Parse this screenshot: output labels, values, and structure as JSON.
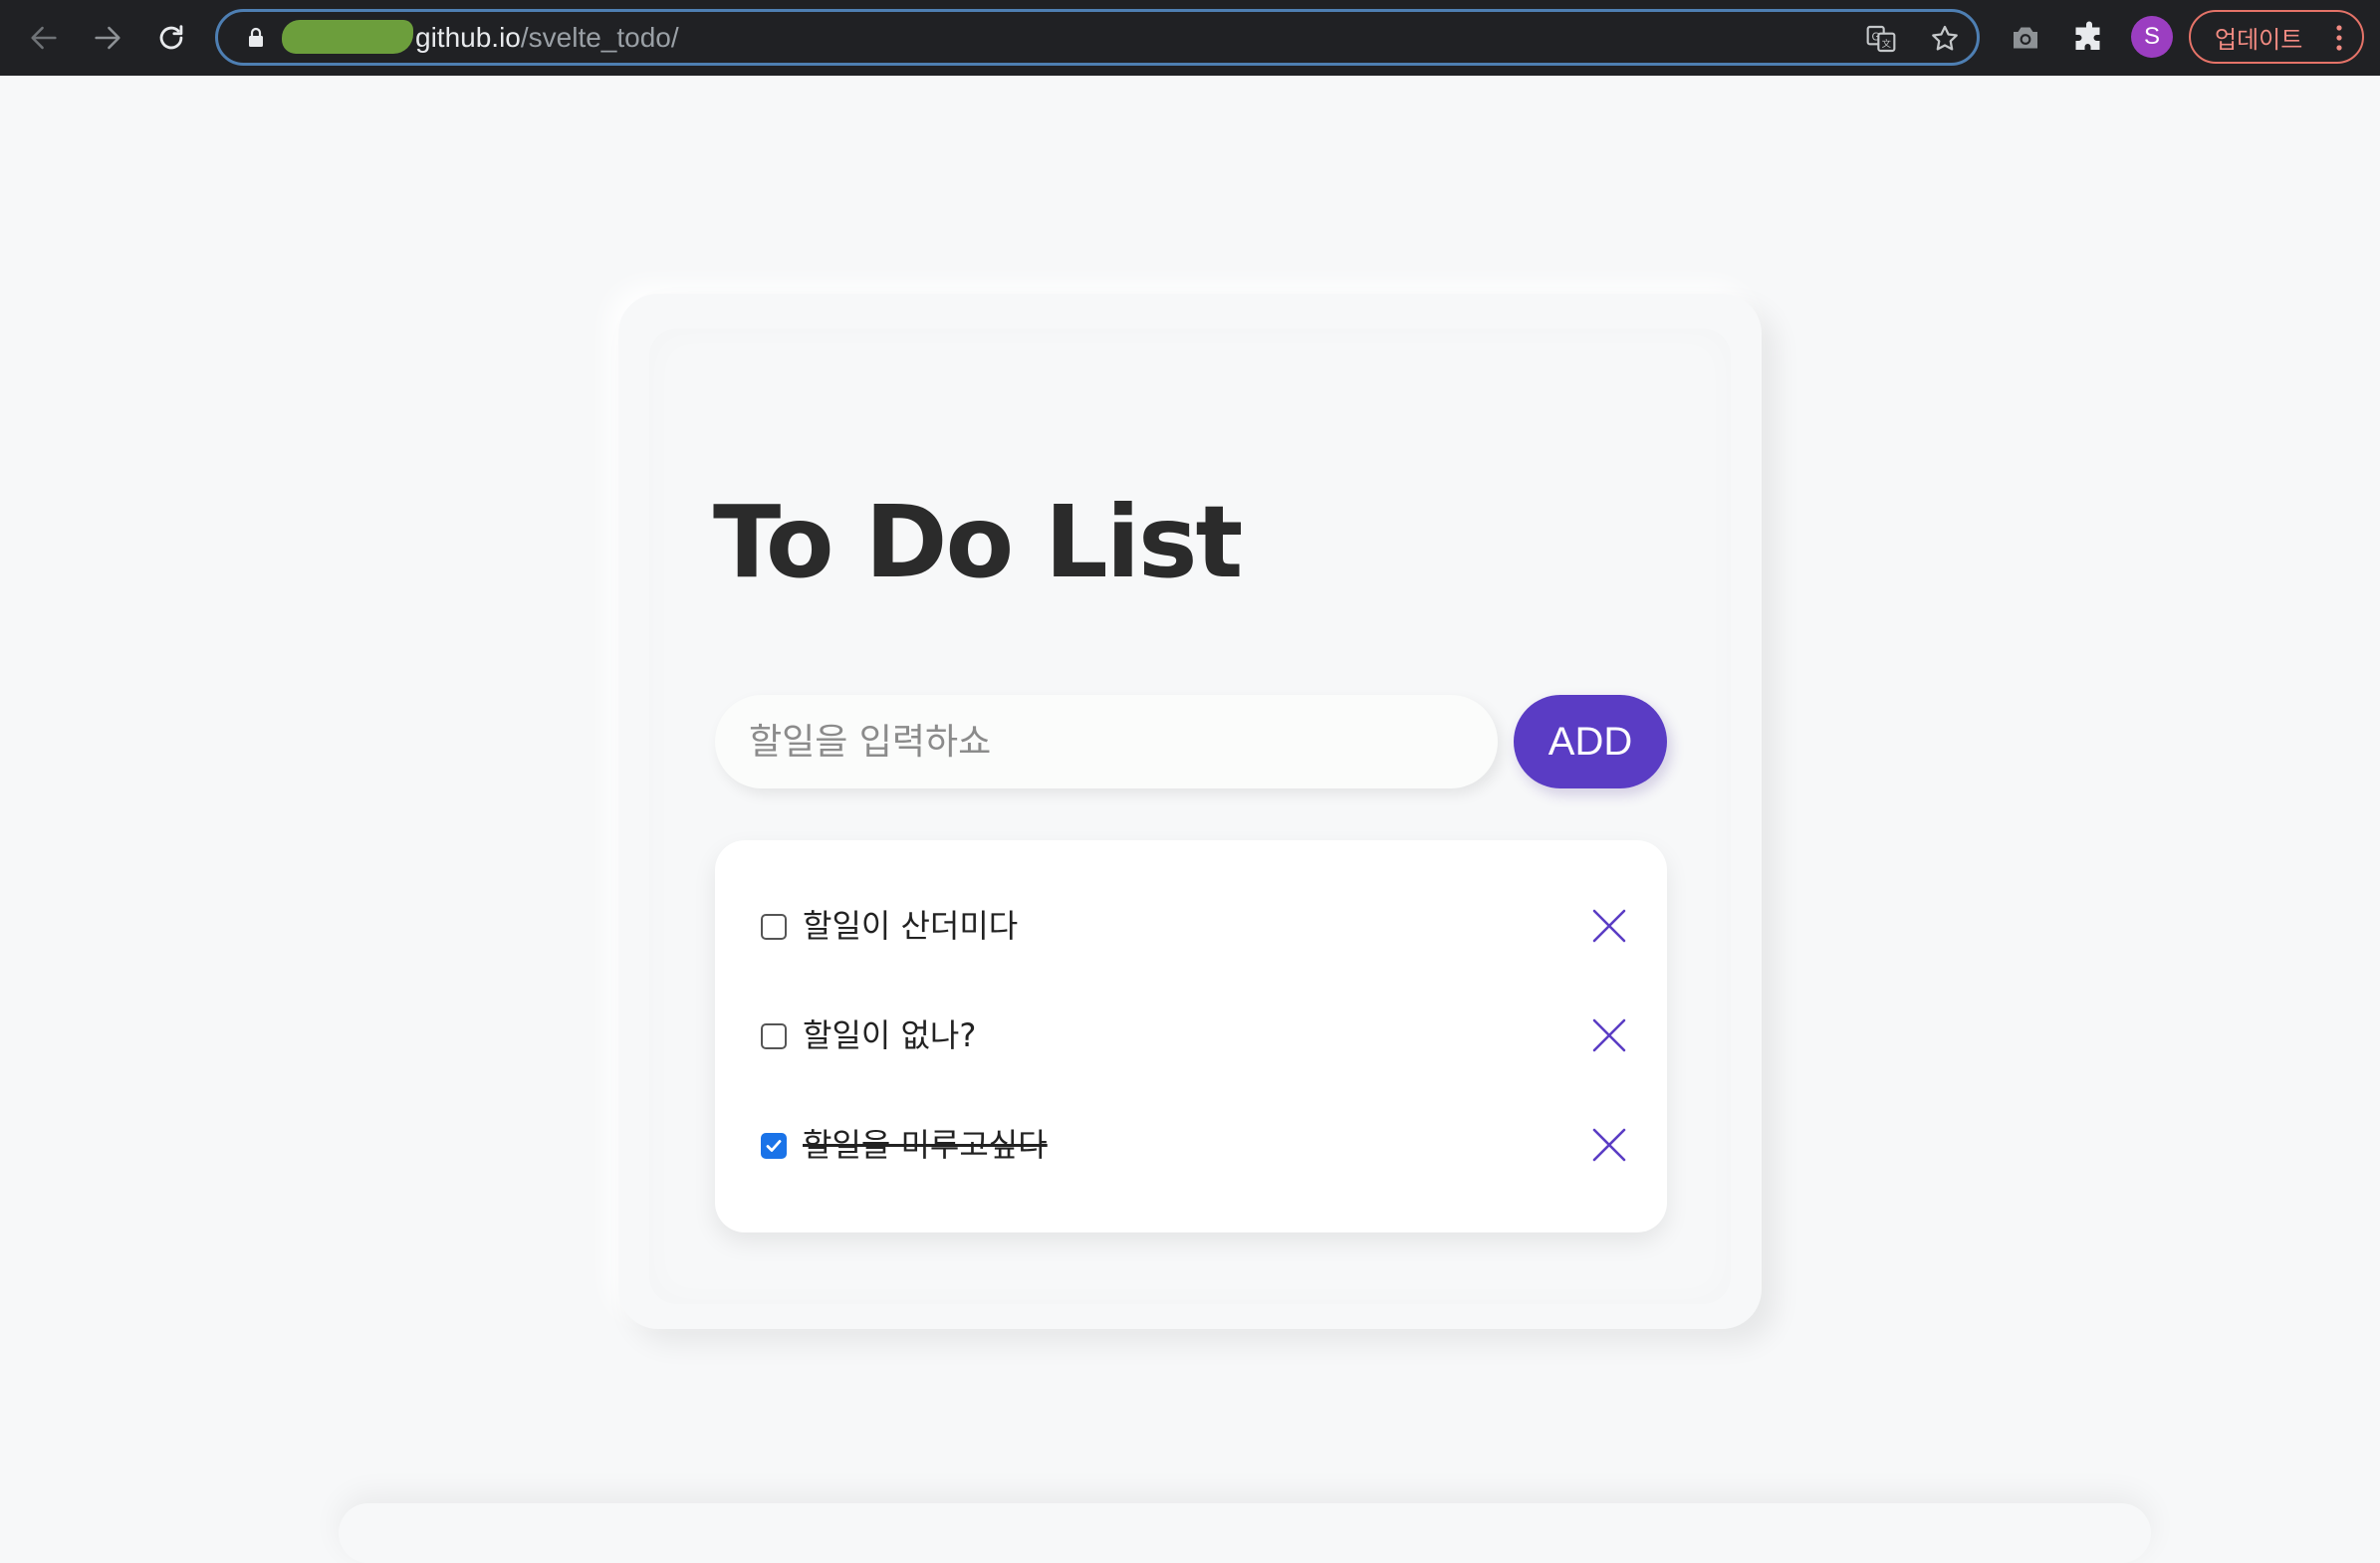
{
  "browser": {
    "url_host": "github.io",
    "url_path": "/svelte_todo/",
    "avatar_letter": "S",
    "update_label": "업데이트",
    "icons": {
      "back": "arrow-left-icon",
      "forward": "arrow-right-icon",
      "reload": "reload-icon",
      "lock": "lock-icon",
      "translate": "translate-icon",
      "bookmark": "star-icon",
      "screenshot": "camera-icon",
      "extensions": "puzzle-icon",
      "menu": "kebab-icon"
    },
    "colors": {
      "frame": "#202124",
      "omnibox_border": "#4e7fb3",
      "update_accent": "#e57368",
      "avatar": "#9b3ec1"
    }
  },
  "app": {
    "title": "To Do List",
    "input": {
      "placeholder": "할일을 입력하쇼",
      "value": ""
    },
    "add_label": "ADD",
    "todos": [
      {
        "text": "할일이 산더미다",
        "done": false
      },
      {
        "text": "할일이 없나?",
        "done": false
      },
      {
        "text": "할일을 미루고싶다",
        "done": true
      }
    ],
    "colors": {
      "accent": "#5a3cc4",
      "background": "#f7f8f9",
      "checkbox_checked": "#1a73e8"
    }
  }
}
